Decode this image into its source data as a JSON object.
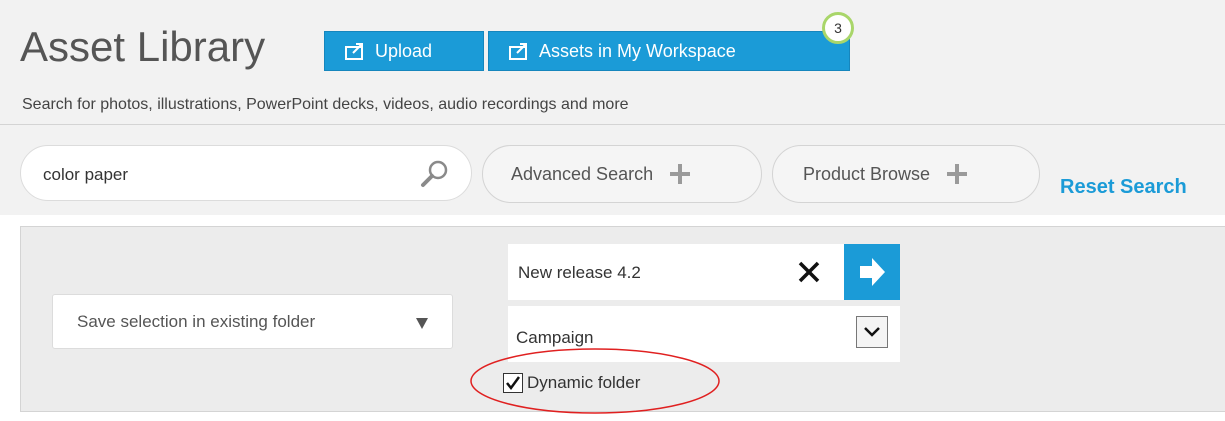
{
  "header": {
    "title": "Asset Library",
    "upload_label": "Upload",
    "workspace_label": "Assets in My Workspace",
    "workspace_count": "3",
    "subtitle": "Search for photos, illustrations, PowerPoint decks, videos, audio recordings and more"
  },
  "search": {
    "value": "color paper",
    "advanced_label": "Advanced Search",
    "product_label": "Product Browse",
    "reset_label": "Reset Search"
  },
  "save_panel": {
    "folder_mode": "Save selection in existing folder",
    "folder_name": "New release 4.2",
    "folder_type": "Campaign",
    "dynamic_label": "Dynamic folder",
    "dynamic_checked": true
  },
  "colors": {
    "accent": "#1b9bd7",
    "badge_ring": "#a9d66a",
    "annotation": "#e02020"
  },
  "icons": {
    "upload": "upload-icon",
    "workspace": "upload-icon",
    "search": "search-icon",
    "plus": "plus-icon",
    "clear": "close-icon",
    "submit": "arrow-right-icon",
    "dropdown": "triangle-down-icon",
    "select": "chevron-down-icon",
    "checkbox": "checkmark-icon"
  }
}
